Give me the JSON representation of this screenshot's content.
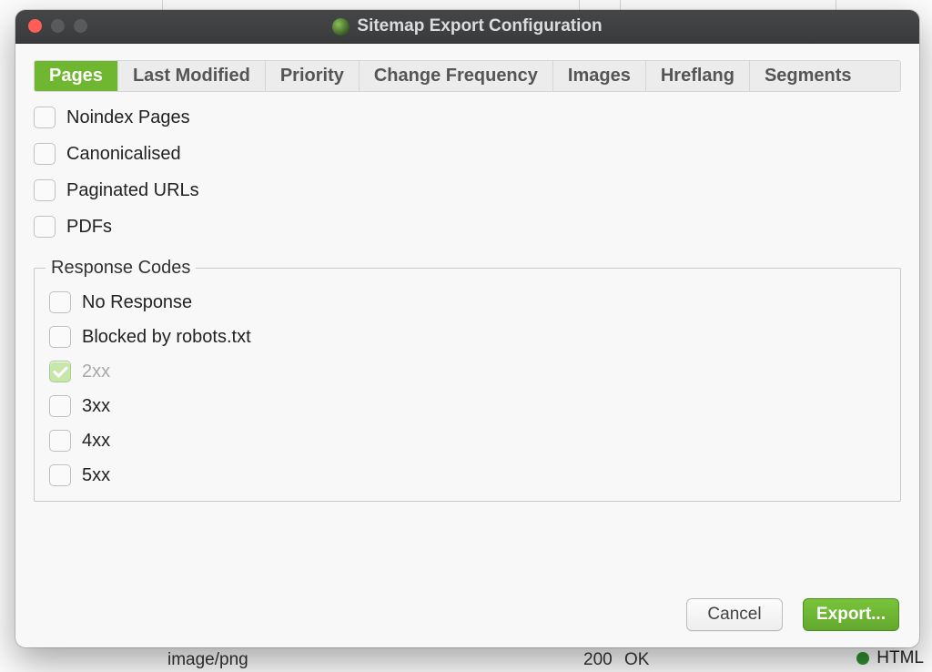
{
  "bg": {
    "row_image": "image/png",
    "row_status_code": "200",
    "row_status_text": "OK",
    "badge": "HTML"
  },
  "dialog": {
    "title": "Sitemap Export Configuration",
    "tabs": [
      "Pages",
      "Last Modified",
      "Priority",
      "Change Frequency",
      "Images",
      "Hreflang",
      "Segments"
    ],
    "active_tab": 0,
    "checks": {
      "noindex": "Noindex Pages",
      "canonicalised": "Canonicalised",
      "paginated": "Paginated URLs",
      "pdfs": "PDFs"
    },
    "group_title": "Response Codes",
    "resp": {
      "no_response": "No Response",
      "blocked": "Blocked by robots.txt",
      "r2xx": "2xx",
      "r3xx": "3xx",
      "r4xx": "4xx",
      "r5xx": "5xx"
    },
    "buttons": {
      "cancel": "Cancel",
      "export": "Export..."
    }
  }
}
